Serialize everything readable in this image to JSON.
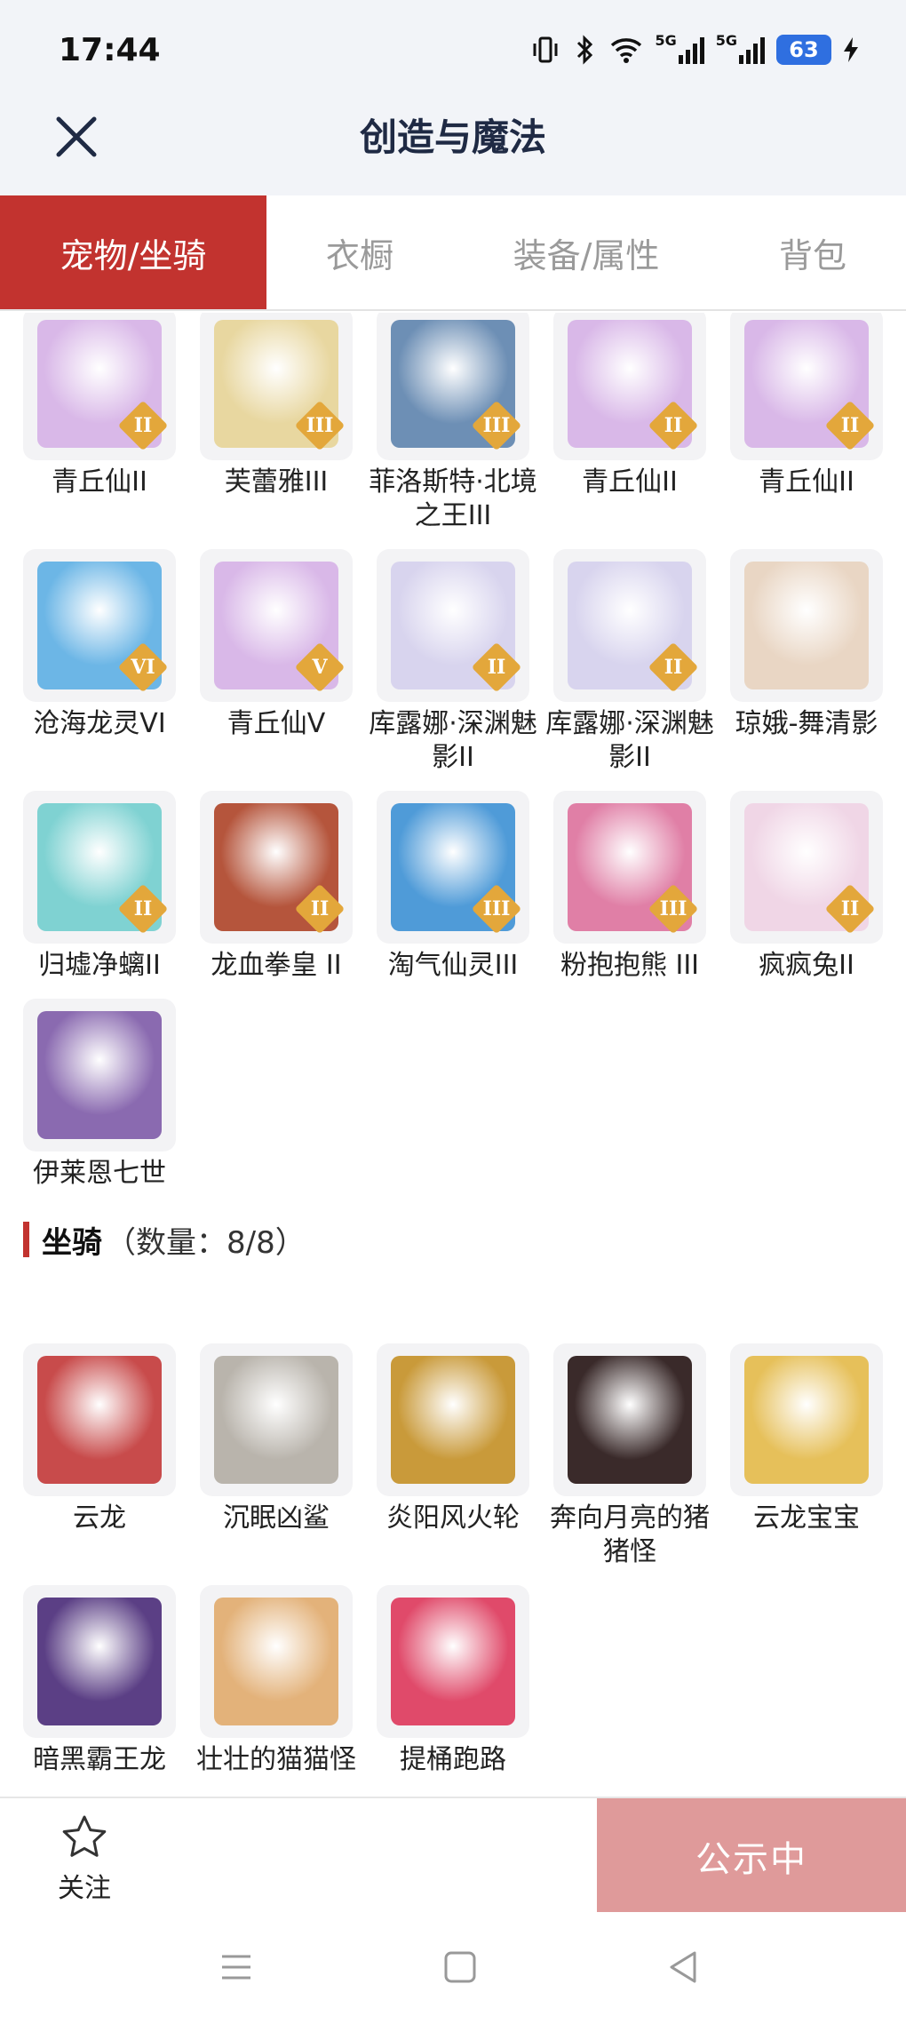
{
  "status_bar": {
    "time": "17:44",
    "network": "5G",
    "battery": "63"
  },
  "nav": {
    "title": "创造与魔法"
  },
  "tabs": [
    {
      "label": "宠物/坐骑",
      "active": true
    },
    {
      "label": "衣橱",
      "active": false
    },
    {
      "label": "装备/属性",
      "active": false
    },
    {
      "label": "背包",
      "active": false
    }
  ],
  "pets": [
    {
      "name": "青丘仙II",
      "badge": "II",
      "color": "#d9b8e8"
    },
    {
      "name": "芙蕾雅III",
      "badge": "III",
      "color": "#e8d7a0"
    },
    {
      "name": "菲洛斯特·北境之王III",
      "badge": "III",
      "color": "#6d8fb5"
    },
    {
      "name": "青丘仙II",
      "badge": "II",
      "color": "#d9b8e8"
    },
    {
      "name": "青丘仙II",
      "badge": "II",
      "color": "#d9b8e8"
    },
    {
      "name": "沧海龙灵VI",
      "badge": "VI",
      "color": "#6cb6e6"
    },
    {
      "name": "青丘仙V",
      "badge": "V",
      "color": "#d9b8e8"
    },
    {
      "name": "库露娜·深渊魅影II",
      "badge": "II",
      "color": "#d8d4ee"
    },
    {
      "name": "库露娜·深渊魅影II",
      "badge": "II",
      "color": "#d8d4ee"
    },
    {
      "name": "琼娥-舞清影",
      "badge": "",
      "color": "#e9d6c4"
    },
    {
      "name": "归墟净螭II",
      "badge": "II",
      "color": "#7fd2d2"
    },
    {
      "name": "龙血拳皇 II",
      "badge": "II",
      "color": "#b5553c"
    },
    {
      "name": "淘气仙灵III",
      "badge": "III",
      "color": "#4f9bd8"
    },
    {
      "name": "粉抱抱熊 III",
      "badge": "III",
      "color": "#e07fa6"
    },
    {
      "name": "疯疯兔II",
      "badge": "II",
      "color": "#f0d6e6"
    },
    {
      "name": "伊莱恩七世",
      "badge": "",
      "color": "#8a6ab0"
    }
  ],
  "mounts_section": {
    "title": "坐骑",
    "count": "（数量：8/8）"
  },
  "mounts": [
    {
      "name": "云龙",
      "color": "#c84b4b"
    },
    {
      "name": "沉眠凶鲨",
      "color": "#b9b4ac"
    },
    {
      "name": "炎阳风火轮",
      "color": "#c99a3a"
    },
    {
      "name": "奔向月亮的猪猪怪",
      "color": "#3a2a2a"
    },
    {
      "name": "云龙宝宝",
      "color": "#e6c05a"
    },
    {
      "name": "暗黑霸王龙",
      "color": "#5b3f85"
    },
    {
      "name": "壮壮的猫猫怪",
      "color": "#e3b27a"
    },
    {
      "name": "提桶跑路",
      "color": "#e04a6a"
    }
  ],
  "bottom": {
    "follow_label": "关注",
    "publish_label": "公示中"
  },
  "colors": {
    "accent": "#c2332f",
    "publish_bg": "#df9a9a",
    "badge": "#e3a73b"
  }
}
